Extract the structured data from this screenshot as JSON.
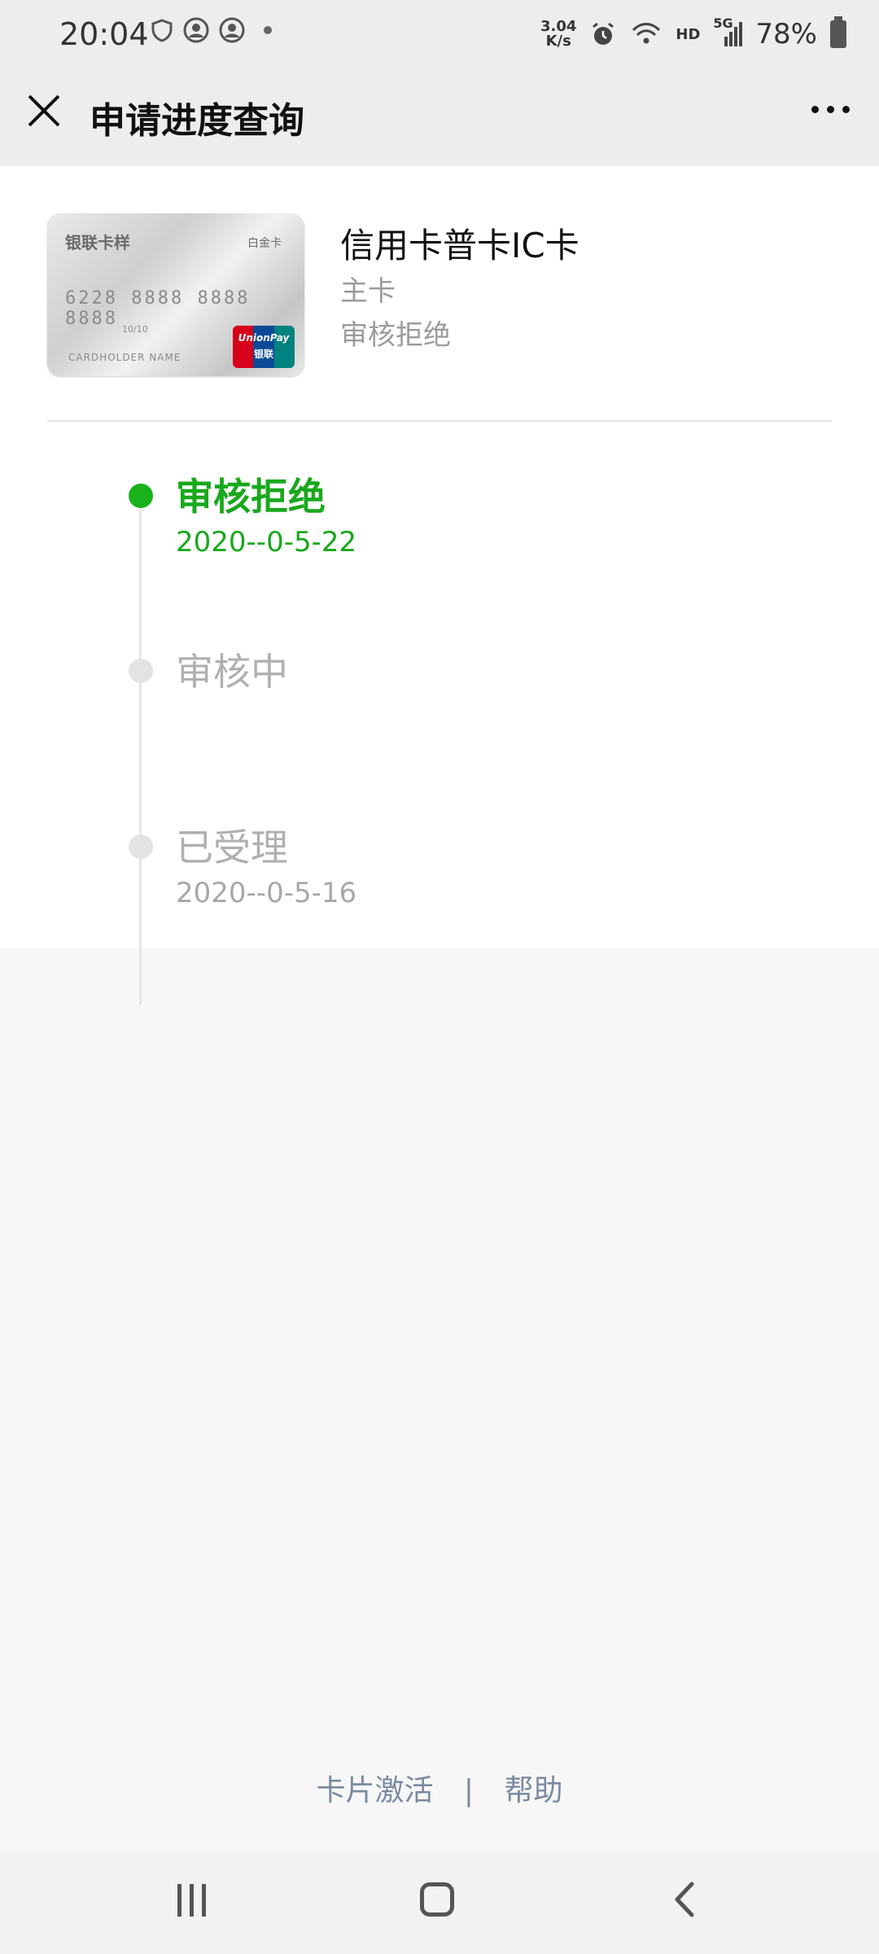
{
  "status_bar": {
    "time": "20:04",
    "speed_value": "3.04",
    "speed_unit": "K/s",
    "network": "HD",
    "signal": "5G",
    "battery": "78%"
  },
  "nav": {
    "title": "申请进度查询",
    "close_icon": "close-icon",
    "more_icon": "more-icon"
  },
  "card": {
    "brand_text": "银联卡样",
    "tier_text": "白金卡",
    "number_text": "6228 8888 8888 8888",
    "valid_text": "10/10",
    "holder_text": "CARDHOLDER NAME",
    "logo_text": "UnionPay",
    "logo_cn": "银联",
    "name": "信用卡普卡IC卡",
    "type": "主卡",
    "status": "审核拒绝"
  },
  "timeline": [
    {
      "title": "审核拒绝",
      "date": "2020--0-5-22",
      "active": true
    },
    {
      "title": "审核中",
      "date": "",
      "active": false
    },
    {
      "title": "已受理",
      "date": "2020--0-5-16",
      "active": false
    }
  ],
  "footer": {
    "activate_label": "卡片激活",
    "separator": "|",
    "help_label": "帮助"
  },
  "colors": {
    "accent_green": "#19a81c",
    "link_blue_gray": "#7a8aa0",
    "header_bg": "#ededed"
  }
}
